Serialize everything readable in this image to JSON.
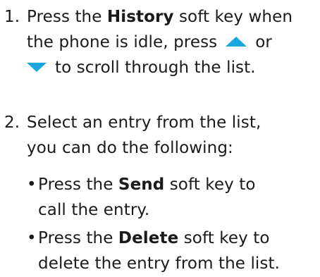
{
  "steps": [
    {
      "number": "1.",
      "lines": [
        {
          "pre": "Press the ",
          "bold": "History",
          "post": " soft key when"
        },
        {
          "text_a": "the phone is idle, press",
          "text_b": "or"
        },
        {
          "text": "to scroll through the list."
        }
      ]
    },
    {
      "number": "2.",
      "lines": [
        {
          "text": "Select an entry from the list,"
        },
        {
          "text": "you can do the following:"
        }
      ],
      "bullets": [
        {
          "bullet": "•",
          "lines": [
            {
              "pre": "Press the ",
              "bold": "Send",
              "post": " soft key to"
            },
            {
              "text": "call the entry."
            }
          ]
        },
        {
          "bullet": "•",
          "lines": [
            {
              "pre": "Press the ",
              "bold": "Delete",
              "post": " soft key to"
            },
            {
              "text": "delete the entry from the list."
            }
          ]
        }
      ]
    }
  ],
  "icons": {
    "up": "up-arrow-triangle",
    "down": "down-arrow-triangle",
    "color": "#1aa7e0"
  }
}
